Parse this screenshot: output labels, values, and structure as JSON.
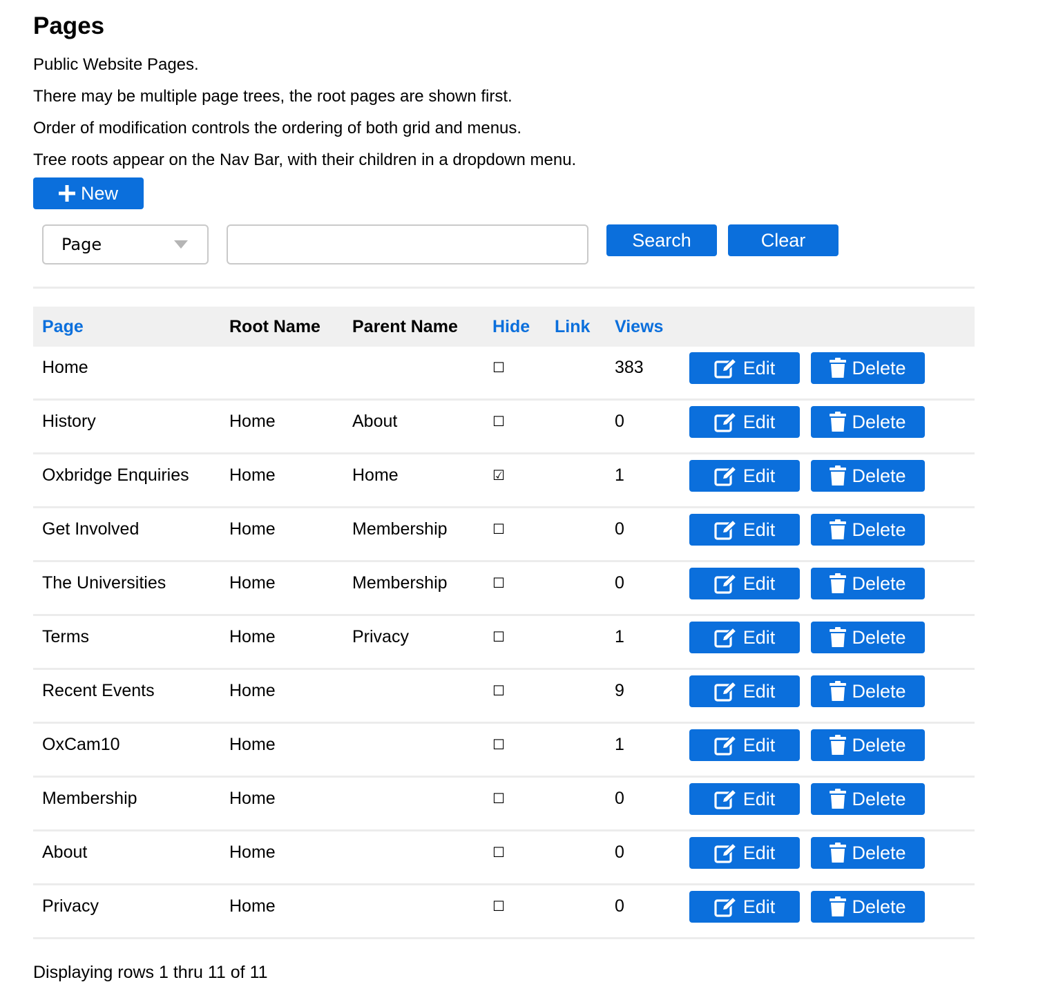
{
  "page": {
    "title": "Pages",
    "descriptions": [
      "Public Website Pages.",
      "There may be multiple page trees, the root pages are shown first.",
      "Order of modification controls the ordering of both grid and menus.",
      "Tree roots appear on the Nav Bar, with their children in a dropdown menu."
    ]
  },
  "toolbar": {
    "new_label": "New",
    "select_value": "Page",
    "search_value": "",
    "search_label": "Search",
    "clear_label": "Clear"
  },
  "table": {
    "headers": {
      "page": "Page",
      "root_name": "Root Name",
      "parent_name": "Parent Name",
      "hide": "Hide",
      "link": "Link",
      "views": "Views"
    },
    "edit_label": "Edit",
    "delete_label": "Delete",
    "rows": [
      {
        "page": "Home",
        "root": "",
        "parent": "",
        "hide": "☐",
        "link": "",
        "views": "383"
      },
      {
        "page": "History",
        "root": "Home",
        "parent": "About",
        "hide": "☐",
        "link": "",
        "views": "0"
      },
      {
        "page": "Oxbridge Enquiries",
        "root": "Home",
        "parent": "Home",
        "hide": "☑",
        "link": "",
        "views": "1"
      },
      {
        "page": "Get Involved",
        "root": "Home",
        "parent": "Membership",
        "hide": "☐",
        "link": "",
        "views": "0"
      },
      {
        "page": "The Universities",
        "root": "Home",
        "parent": "Membership",
        "hide": "☐",
        "link": "",
        "views": "0"
      },
      {
        "page": "Terms",
        "root": "Home",
        "parent": "Privacy",
        "hide": "☐",
        "link": "",
        "views": "1"
      },
      {
        "page": "Recent Events",
        "root": "Home",
        "parent": "",
        "hide": "☐",
        "link": "",
        "views": "9"
      },
      {
        "page": "OxCam10",
        "root": "Home",
        "parent": "",
        "hide": "☐",
        "link": "",
        "views": "1"
      },
      {
        "page": "Membership",
        "root": "Home",
        "parent": "",
        "hide": "☐",
        "link": "",
        "views": "0"
      },
      {
        "page": "About",
        "root": "Home",
        "parent": "",
        "hide": "☐",
        "link": "",
        "views": "0"
      },
      {
        "page": "Privacy",
        "root": "Home",
        "parent": "",
        "hide": "☐",
        "link": "",
        "views": "0"
      }
    ],
    "footer": "Displaying rows 1 thru 11 of 11"
  },
  "colors": {
    "accent": "#0b6fdc",
    "header_bg": "#f0f0f0",
    "rule": "#ececec"
  },
  "icons": {
    "new": "plus-icon",
    "edit": "edit-icon",
    "delete": "trash-icon",
    "select": "chevron-down-icon"
  }
}
